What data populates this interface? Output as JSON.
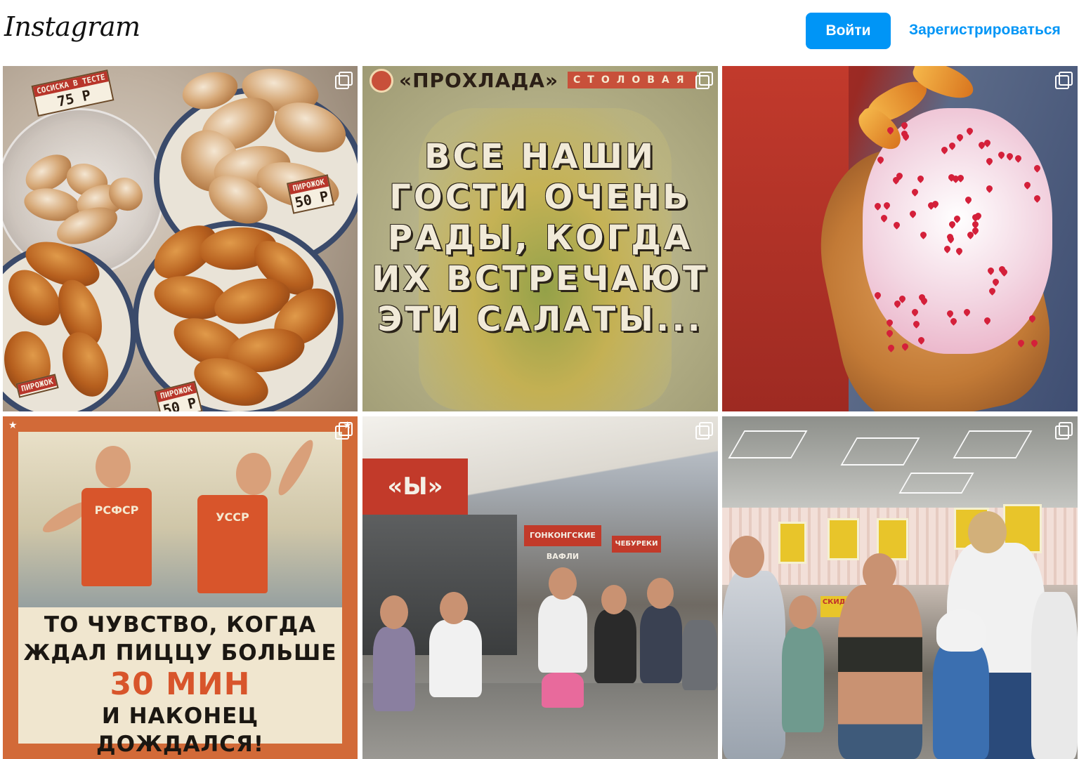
{
  "header": {
    "logo_text": "Instagram",
    "login_label": "Войти",
    "signup_label": "Зарегистрироваться"
  },
  "colors": {
    "accent": "#0095f6",
    "background": "#ffffff"
  },
  "posts": [
    {
      "id_label": "pastries",
      "icon": "carousel-icon",
      "price_tags": [
        {
          "label": "СОСИСКА В ТЕСТЕ",
          "price": "75 Р"
        },
        {
          "label": "ПИРОЖОК",
          "price": "50 Р"
        },
        {
          "label": "ПИРОЖОК",
          "price": ""
        },
        {
          "label": "ПИРОЖОК",
          "price": "50 Р"
        }
      ]
    },
    {
      "id_label": "salads-poster",
      "icon": "carousel-icon",
      "brand": "«ПРОХЛАДА»",
      "brand_sub": "СТОЛОВАЯ",
      "text_lines": [
        "ВСЕ НАШИ",
        "ГОСТИ ОЧЕНЬ",
        "РАДЫ, КОГДА",
        "ИХ ВСТРЕЧАЮТ",
        "ЭТИ САЛАТЫ..."
      ]
    },
    {
      "id_label": "bubble-waffle",
      "icon": "carousel-icon"
    },
    {
      "id_label": "soviet-pizza-poster",
      "icon": "carousel-icon",
      "jersey_left": "РСФСР",
      "jersey_right": "УССР",
      "text_lines": [
        "ТО ЧУВСТВО, КОГДА",
        "ЖДАЛ ПИЦЦУ БОЛЬШЕ"
      ],
      "accent_line": "30 МИН",
      "text_lines_after": [
        "И НАКОНЕЦ",
        "ДОЖДАЛСЯ!"
      ]
    },
    {
      "id_label": "street-crowd",
      "icon": "carousel-icon",
      "sign_left": "«Ы»",
      "sign_center": "ГОНКОНГСКИЕ ВАФЛИ",
      "sign_right": "ЧЕБУРЕКИ"
    },
    {
      "id_label": "food-court-queue",
      "icon": "carousel-icon",
      "sign": "СКИДКИ"
    }
  ]
}
